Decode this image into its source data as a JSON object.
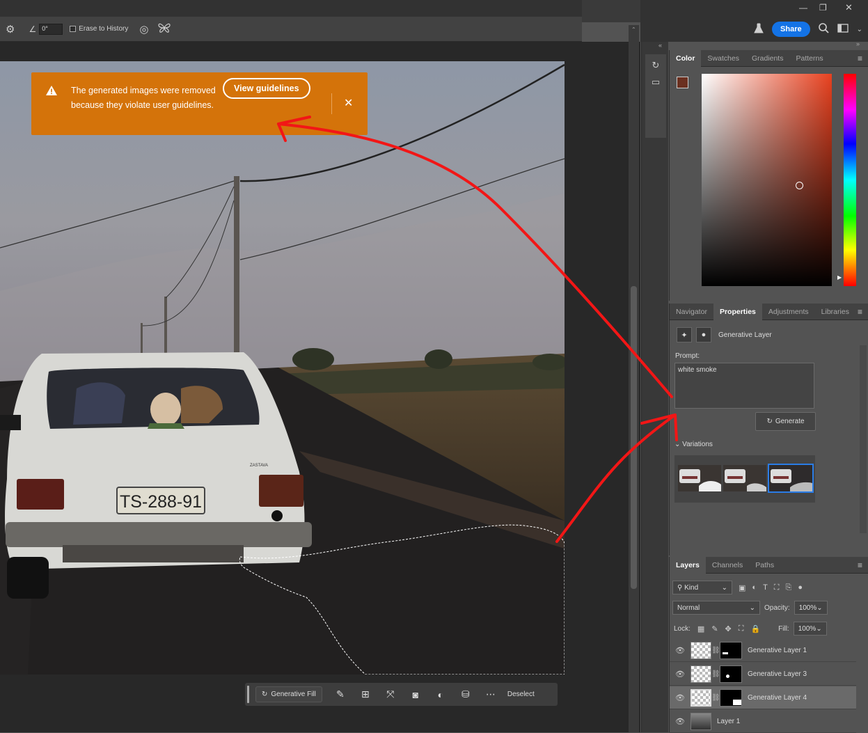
{
  "window": {
    "minimize": "—",
    "restore": "❐",
    "close": "✕"
  },
  "options_bar": {
    "settings_icon": "gear-icon",
    "angle_icon": "angle-icon",
    "angle_value": "0°",
    "erase_to_history_label": "Erase to History",
    "erase_to_history_checked": false,
    "brush_pressure_icon": "pressure-icon",
    "symmetry_icon": "butterfly-icon"
  },
  "app_bar": {
    "share_label": "Share"
  },
  "toast": {
    "message": "The generated images were removed because they violate user guidelines.",
    "button_label": "View guidelines",
    "close_glyph": "✕",
    "background_color": "#d4730a"
  },
  "context_bar": {
    "generative_fill_label": "Generative Fill",
    "deselect_label": "Deselect"
  },
  "color_panel": {
    "tabs": [
      "Color",
      "Swatches",
      "Gradients",
      "Patterns"
    ],
    "active_tab": "Color",
    "foreground_color": "#6b3020",
    "background_color": "#ffffff"
  },
  "properties_panel": {
    "tabs": [
      "Navigator",
      "Properties",
      "Adjustments",
      "Libraries"
    ],
    "active_tab": "Properties",
    "layer_type": "Generative Layer",
    "prompt_label": "Prompt:",
    "prompt_value": "white smoke",
    "generate_label": "Generate",
    "variations_label": "Variations",
    "selected_variation": 3
  },
  "layers_panel": {
    "tabs": [
      "Layers",
      "Channels",
      "Paths"
    ],
    "active_tab": "Layers",
    "filter_kind": "Kind",
    "blend_mode": "Normal",
    "opacity_label": "Opacity:",
    "opacity_value": "100%",
    "lock_label": "Lock:",
    "fill_label": "Fill:",
    "fill_value": "100%",
    "layers": [
      {
        "name": "Generative Layer 1",
        "selected": false
      },
      {
        "name": "Generative Layer 3",
        "selected": false
      },
      {
        "name": "Generative Layer 4",
        "selected": true
      },
      {
        "name": "Layer 1",
        "selected": false
      }
    ]
  },
  "photo": {
    "license_plate": "TS-288-91",
    "car_badge": "ZASTAVA"
  }
}
